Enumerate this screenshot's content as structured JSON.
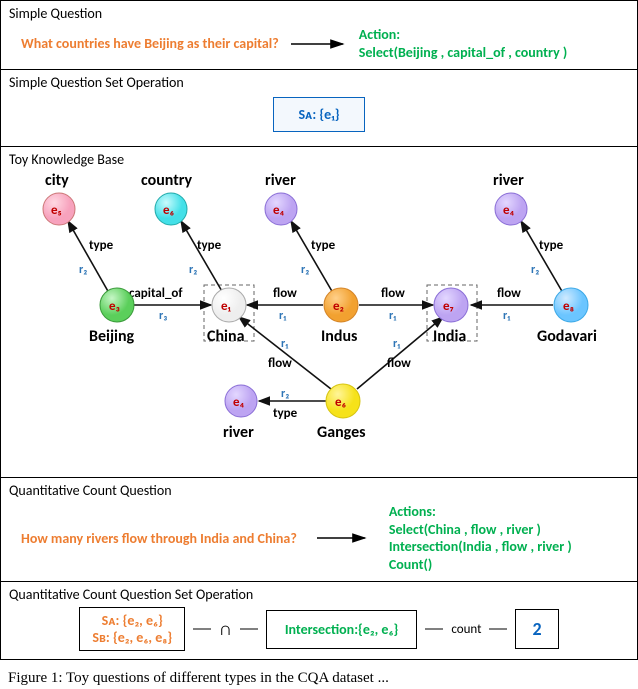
{
  "panels": {
    "simpleQ": {
      "title": "Simple Question",
      "question": "What countries have Beijing as their capital?",
      "action_header": "Action:",
      "action_body": "Select(Beijing , capital_of , country )"
    },
    "simpleSet": {
      "title": "Simple Question Set Operation",
      "box": "Sᴀ: {e₁}"
    },
    "kb": {
      "title": "Toy Knowledge Base",
      "type_labels": {
        "city": "city",
        "country": "country",
        "river_top_left": "river",
        "river_top_right": "river",
        "river_bottom": "river"
      },
      "entity_labels": {
        "e1": "e₁",
        "e2": "e₂",
        "e3": "e₃",
        "e4": "e₄",
        "e5": "e₅",
        "e6": "e₆",
        "e7": "e₇",
        "e8": "e₈"
      },
      "name_labels": {
        "beijing": "Beijing",
        "china": "China",
        "indus": "Indus",
        "india": "India",
        "godavari": "Godavari",
        "ganges": "Ganges"
      },
      "rel_labels": {
        "r1": "r₁",
        "r2": "r₂",
        "r3": "r₃",
        "type": "type",
        "flow": "flow",
        "capital_of": "capital_of"
      }
    },
    "quantQ": {
      "title": "Quantitative Count Question",
      "question": "How many rivers flow through India and China?",
      "action_header": "Actions:",
      "action_lines": [
        "Select(China , flow , river )",
        "Intersection(India , flow , river )",
        "Count()"
      ]
    },
    "quantSet": {
      "title": "Quantitative Count Question Set Operation",
      "sa": "Sᴀ: {e₂, e₆}",
      "sb": "Sʙ: {e₂, e₆, e₈}",
      "intersection_symbol": "∩",
      "inter_box": "Intersection:{e₂, e₆}",
      "count_label": "count",
      "count_value": "2"
    }
  },
  "caption": "Figure 1: Toy questions of different types in the CQA dataset ...",
  "chart_data": {
    "type": "diagram",
    "kind": "knowledge-graph",
    "entities": [
      {
        "id": "e1",
        "name": "China",
        "type": "country"
      },
      {
        "id": "e2",
        "name": "Indus",
        "type": "river"
      },
      {
        "id": "e3",
        "name": "Beijing",
        "type": "city"
      },
      {
        "id": "e4",
        "name": null,
        "type": "river",
        "note": "river type node (three occurrences)"
      },
      {
        "id": "e5",
        "name": null,
        "type": "city",
        "note": "city type node"
      },
      {
        "id": "e6",
        "name": "Ganges",
        "type": "river",
        "note_also": "country type-node e6"
      },
      {
        "id": "e7",
        "name": "India",
        "type": "country"
      },
      {
        "id": "e8",
        "name": "Godavari",
        "type": "river"
      }
    ],
    "relations": [
      {
        "from": "e3",
        "to": "e5",
        "rel": "r2",
        "label": "type"
      },
      {
        "from": "e1",
        "to": "e6",
        "rel": "r2",
        "label": "type",
        "note": "China type country (e6 label used on country type-node)"
      },
      {
        "from": "e3",
        "to": "e1",
        "rel": "r3",
        "label": "capital_of"
      },
      {
        "from": "e2",
        "to": "e1",
        "rel": "r1",
        "label": "flow"
      },
      {
        "from": "e2",
        "to": "e4",
        "rel": "r2",
        "label": "type"
      },
      {
        "from": "e2",
        "to": "e7",
        "rel": "r1",
        "label": "flow"
      },
      {
        "from": "e6",
        "to": "e1",
        "rel": "r1",
        "label": "flow",
        "note": "Ganges flow China"
      },
      {
        "from": "e6",
        "to": "e7",
        "rel": "r1",
        "label": "flow",
        "note": "Ganges flow India"
      },
      {
        "from": "e6",
        "to": "e4",
        "rel": "r2",
        "label": "type",
        "note": "Ganges type river (bottom)"
      },
      {
        "from": "e8",
        "to": "e7",
        "rel": "r1",
        "label": "flow"
      },
      {
        "from": "e8",
        "to": "e4",
        "rel": "r2",
        "label": "type",
        "note": "Godavari type river (top-right)"
      }
    ],
    "simple_question": {
      "text": "What countries have Beijing as their capital?",
      "action": "Select(Beijing, capital_of, country)",
      "result_set": [
        "e1"
      ]
    },
    "quantitative_count_question": {
      "text": "How many rivers flow through India and China?",
      "actions": [
        "Select(China, flow, river)",
        "Intersection(India, flow, river)",
        "Count()"
      ],
      "SA": [
        "e2",
        "e6"
      ],
      "SB": [
        "e2",
        "e6",
        "e8"
      ],
      "intersection": [
        "e2",
        "e6"
      ],
      "count": 2
    }
  }
}
